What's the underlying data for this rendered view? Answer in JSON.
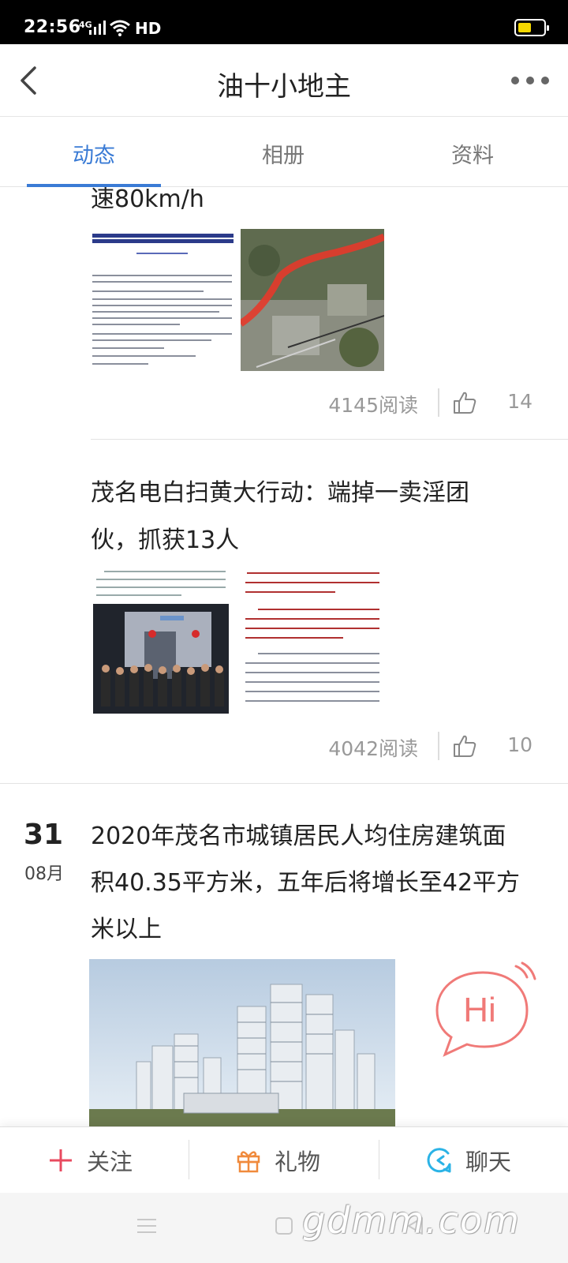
{
  "status_bar": {
    "time": "22:56",
    "network": "4G",
    "hd": "HD"
  },
  "header": {
    "title": "油十小地主"
  },
  "tabs": [
    {
      "label": "动态",
      "active": true
    },
    {
      "label": "相册",
      "active": false
    },
    {
      "label": "资料",
      "active": false
    }
  ],
  "posts": [
    {
      "text_tail": "速80km/h",
      "reads": "4145阅读",
      "likes": "14"
    },
    {
      "title": "茂名电白扫黄大行动：端掉一卖淫团伙，抓获13人",
      "title_line1": "茂名电白扫黄大行动：端掉一卖淫团",
      "title_line2": "伙，抓获13人",
      "reads": "4042阅读",
      "likes": "10"
    },
    {
      "date_day": "31",
      "date_month": "08月",
      "title_line1": "2020年茂名市城镇居民人均住房建筑面",
      "title_line2": "积40.35平方米，五年后将增长至42平方",
      "title_line3": "米以上"
    }
  ],
  "chat_bubble": {
    "text": "Hi"
  },
  "bottom_bar": {
    "follow": "关注",
    "gift": "礼物",
    "chat": "聊天"
  },
  "watermark": "gdmm.com",
  "colors": {
    "accent": "#3a7bd5",
    "follow": "#e84a5f",
    "gift": "#f08a3c",
    "chat": "#2bb3e6",
    "hi": "#f07a78"
  }
}
